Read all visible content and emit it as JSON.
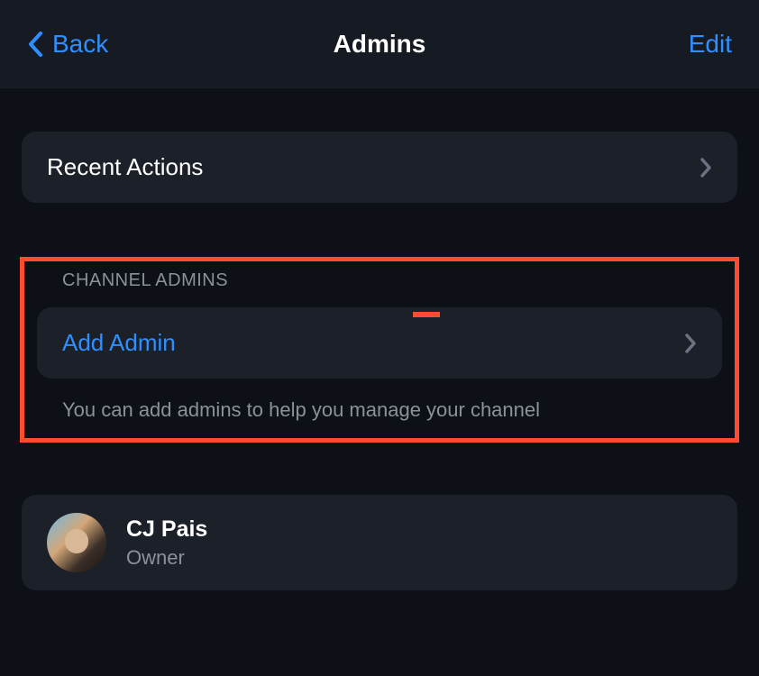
{
  "header": {
    "back_label": "Back",
    "title": "Admins",
    "edit_label": "Edit"
  },
  "recent_actions": {
    "label": "Recent Actions"
  },
  "channel_admins": {
    "section_title": "CHANNEL ADMINS",
    "add_label": "Add Admin",
    "footer_text": "You can add admins to help you manage your channel"
  },
  "admins": [
    {
      "name": "CJ Pais",
      "role": "Owner"
    }
  ]
}
